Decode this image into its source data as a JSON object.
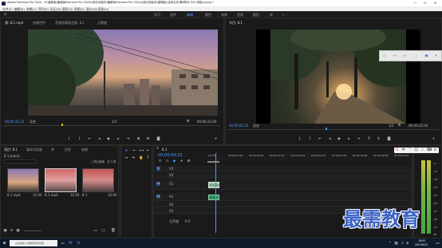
{
  "window": {
    "title": "Adobe Premiere Pro 2020 - D:\\最新版\\最新版Premiere Pro 2020从新手到高手\\最新版Premiere Pro 2020从新手到高手(微课版)\\实例文件\\第8章\\8.1\\8.1调色.prproj *",
    "minimize": "—",
    "maximize": "☐",
    "close": "✕"
  },
  "menu": [
    "文件(F)",
    "编辑(E)",
    "剪辑(C)",
    "序列(S)",
    "标记(M)",
    "图形(G)",
    "视图(V)",
    "窗口(W)",
    "帮助(H)"
  ],
  "workspaces": {
    "home_icon": "home-icon",
    "tabs": [
      "学习",
      "组件",
      "编辑",
      "颜色",
      "效果",
      "音频",
      "图形",
      "库"
    ],
    "active": "编辑",
    "more": "»"
  },
  "source": {
    "tabs": [
      "源: 8.1.mp4",
      "效果控件",
      "音频剪辑混合器: 8.1",
      "元数据"
    ],
    "timecode": "00;00;11;22",
    "zoom": "适合",
    "quality": "1/2",
    "duration": "00;00;32;04"
  },
  "program": {
    "tab": "节目: 8.1",
    "timecode": "00;00;04;22",
    "zoom": "适合",
    "quality": "1/2",
    "duration": "00;00;32;04"
  },
  "project": {
    "tabs": [
      "项目: 8.1",
      "媒体浏览器",
      "库",
      "信息",
      "效果"
    ],
    "file": "8.1.prproj",
    "selection": "1 项已选择，共 3 项",
    "items": [
      {
        "name": "8.1.mp4",
        "duration": "32;04"
      },
      {
        "name": "8.1.mp4",
        "duration": "32;04"
      },
      {
        "name": "8.1",
        "duration": "32;04"
      }
    ]
  },
  "timeline": {
    "tab": "8.1",
    "timecode": "00;00;04;22",
    "ruler": [
      "00;00",
      "00;00;04;29",
      "00;00;09;29",
      "00;00;14;29",
      "00;00;19;29",
      "00;00;24;29",
      "00;00;29;29",
      "00;00;34;28",
      "00;00;39;28",
      "00;00;44;28"
    ],
    "video_tracks": [
      "V3",
      "V2",
      "V1"
    ],
    "audio_tracks": [
      "A1",
      "A2",
      "A3"
    ],
    "master": "主声道",
    "master_value": "0.0",
    "clips": [
      "8.1.mp4"
    ]
  },
  "audio_meter": {
    "scale": [
      "-6",
      "-12",
      "-18",
      "-24",
      "-30",
      "-36",
      "-42",
      "-48",
      "-54"
    ],
    "db_label": "dB"
  },
  "watermark": "最需教育",
  "taskbar": {
    "search_placeholder": "在这里输入你要搜索的内容",
    "time": "16:05",
    "date": "2021/9/22",
    "lang": "中"
  }
}
